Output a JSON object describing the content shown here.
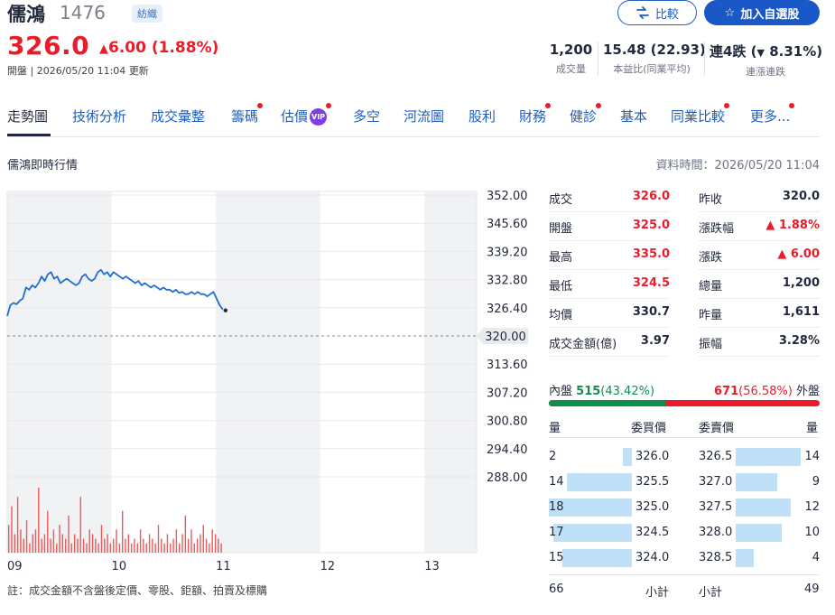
{
  "header": {
    "name": "儒鴻",
    "code": "1476",
    "industry_badge": "紡織",
    "price": "326.0",
    "change_arrow": "▲",
    "change": "6.00",
    "change_pct": "(1.88%)",
    "open_label": "開盤",
    "updated_time": "2026/05/20 11:04",
    "updated_suffix": "更新",
    "compare_label": "比較",
    "watchlist_label": "加入自選股",
    "stats": [
      {
        "value": "1,200",
        "label": "成交量"
      },
      {
        "value": "15.48 (22.93)",
        "label": "本益比(同業平均)"
      },
      {
        "value_prefix": "連4跌",
        "value_arrow": "▼",
        "value_pct": "8.31%",
        "label": "連漲連跌"
      }
    ]
  },
  "tabs": [
    {
      "label": "走勢圖",
      "active": true
    },
    {
      "label": "技術分析"
    },
    {
      "label": "成交彙整"
    },
    {
      "label": "籌碼",
      "dot": true
    },
    {
      "label": "估價",
      "vip": "VIP",
      "dot": true
    },
    {
      "label": "多空"
    },
    {
      "label": "河流圖"
    },
    {
      "label": "股利"
    },
    {
      "label": "財務",
      "dot": true
    },
    {
      "label": "健診",
      "dot": true
    },
    {
      "label": "基本"
    },
    {
      "label": "同業比較",
      "dot": true
    },
    {
      "label": "更多...",
      "dot": true
    }
  ],
  "section": {
    "title": "儒鴻即時行情",
    "data_time_label": "資料時間：",
    "data_time": "2026/05/20 11:04"
  },
  "chart_data": {
    "type": "line",
    "y_ticks": [
      "352.00",
      "345.60",
      "339.20",
      "332.80",
      "326.40",
      "320.00",
      "313.60",
      "307.20",
      "300.80",
      "294.40",
      "288.00"
    ],
    "x_ticks": [
      "09",
      "10",
      "11",
      "12",
      "13"
    ],
    "ylim": [
      288,
      352
    ],
    "reference_price": "320.00",
    "prices": [
      324.5,
      327.0,
      327.5,
      327.2,
      328.0,
      328.5,
      331.0,
      330.5,
      331.5,
      331.0,
      332.0,
      333.5,
      332.5,
      334.0,
      334.5,
      333.0,
      333.5,
      332.0,
      332.5,
      333.0,
      332.5,
      332.0,
      331.5,
      332.0,
      333.5,
      334.0,
      333.0,
      332.5,
      333.0,
      334.5,
      335.0,
      334.0,
      334.5,
      333.5,
      334.5,
      334.0,
      333.5,
      333.0,
      333.5,
      333.0,
      332.5,
      332.0,
      332.5,
      331.5,
      332.0,
      331.5,
      331.0,
      331.5,
      331.0,
      330.5,
      331.0,
      330.5,
      330.5,
      330.0,
      330.5,
      329.8,
      330.0,
      329.5,
      329.5,
      330.0,
      329.5,
      330.0,
      329.5,
      329.5,
      329.0,
      329.5,
      330.0,
      328.5,
      327.0,
      326.0
    ],
    "volumes": [
      6,
      10,
      4,
      12,
      5,
      3,
      7,
      2,
      4,
      5,
      14,
      3,
      4,
      9,
      3,
      5,
      2,
      6,
      4,
      3,
      8,
      2,
      4,
      3,
      12,
      3,
      2,
      5,
      4,
      3,
      2,
      6,
      3,
      4,
      2,
      3,
      5,
      2,
      9,
      3,
      4,
      2,
      3,
      2,
      5,
      3,
      2,
      4,
      3,
      2,
      6,
      3,
      2,
      4,
      2,
      3,
      5,
      2,
      4,
      8,
      3,
      5,
      2,
      3,
      4,
      6,
      3,
      2,
      5,
      4,
      3,
      2
    ]
  },
  "quote": {
    "left": [
      {
        "label": "成交",
        "value": "326.0",
        "color": "#eb1c2a"
      },
      {
        "label": "開盤",
        "value": "325.0",
        "color": "#eb1c2a"
      },
      {
        "label": "最高",
        "value": "335.0",
        "color": "#eb1c2a"
      },
      {
        "label": "最低",
        "value": "324.5",
        "color": "#eb1c2a"
      },
      {
        "label": "均價",
        "value": "330.7",
        "color": "#232a3d"
      },
      {
        "label": "成交金額(億)",
        "value": "3.97",
        "color": "#232a3d"
      }
    ],
    "right": [
      {
        "label": "昨收",
        "value": "320.0",
        "color": "#232a3d"
      },
      {
        "label": "漲跌幅",
        "value": "▲ 1.88%",
        "color": "#eb1c2a"
      },
      {
        "label": "漲跌",
        "value": "▲ 6.00",
        "color": "#eb1c2a"
      },
      {
        "label": "總量",
        "value": "1,200",
        "color": "#232a3d"
      },
      {
        "label": "昨量",
        "value": "1,611",
        "color": "#232a3d"
      },
      {
        "label": "振幅",
        "value": "3.28%",
        "color": "#232a3d"
      }
    ]
  },
  "inout": {
    "in_label": "內盤",
    "in_value": "515",
    "in_pct": "(43.42%)",
    "out_value": "671",
    "out_pct": "(56.58%)",
    "out_label": "外盤",
    "in_ratio": 0.4342
  },
  "orderbook": {
    "bid_head_qty": "量",
    "bid_head_price": "委買價",
    "ask_head_price": "委賣價",
    "ask_head_qty": "量",
    "bids": [
      {
        "qty": "2",
        "price": "326.0",
        "n": 2
      },
      {
        "qty": "14",
        "price": "325.5",
        "n": 14
      },
      {
        "qty": "18",
        "price": "325.0",
        "n": 18
      },
      {
        "qty": "17",
        "price": "324.5",
        "n": 17
      },
      {
        "qty": "15",
        "price": "324.0",
        "n": 15
      }
    ],
    "asks": [
      {
        "price": "326.5",
        "qty": "14",
        "n": 14
      },
      {
        "price": "327.0",
        "qty": "9",
        "n": 9
      },
      {
        "price": "327.5",
        "qty": "12",
        "n": 12
      },
      {
        "price": "328.0",
        "qty": "10",
        "n": 10
      },
      {
        "price": "328.5",
        "qty": "4",
        "n": 4
      }
    ],
    "bid_total": "66",
    "subtotal_label": "小計",
    "ask_subtotal_label": "小計",
    "ask_total": "49"
  },
  "footnote": "註：成交金額不含盤後定價、零股、鉅額、拍賣及標購"
}
